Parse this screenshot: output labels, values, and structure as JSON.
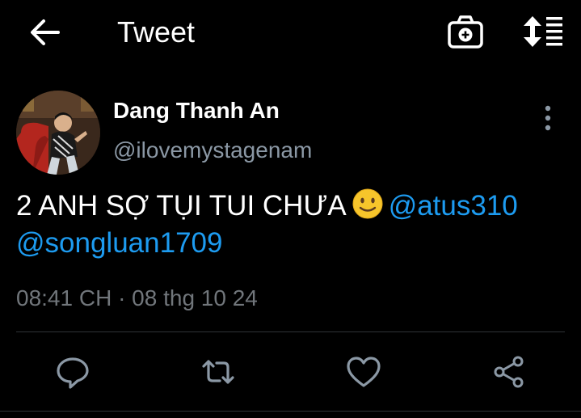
{
  "header": {
    "title": "Tweet",
    "back_icon": "arrow-left-icon",
    "camera_icon": "camera-icon",
    "sort_icon": "sort-icon"
  },
  "tweet": {
    "author_name": "Dang Thanh An",
    "author_handle": "@ilovemystagenam",
    "text": "2 ANH SỢ TỤI TUI CHƯA",
    "emoji": "slightly-smiling-face",
    "mentions": [
      "@atus310",
      "@songluan1709"
    ],
    "timestamp": "08:41 CH · 08 thg 10 24"
  },
  "actions": [
    "reply-icon",
    "retweet-icon",
    "like-icon",
    "share-icon"
  ],
  "colors": {
    "background": "#000000",
    "text": "#ffffff",
    "secondary": "#8b98a5",
    "link": "#1d9bf0",
    "divider": "#2f3336"
  }
}
